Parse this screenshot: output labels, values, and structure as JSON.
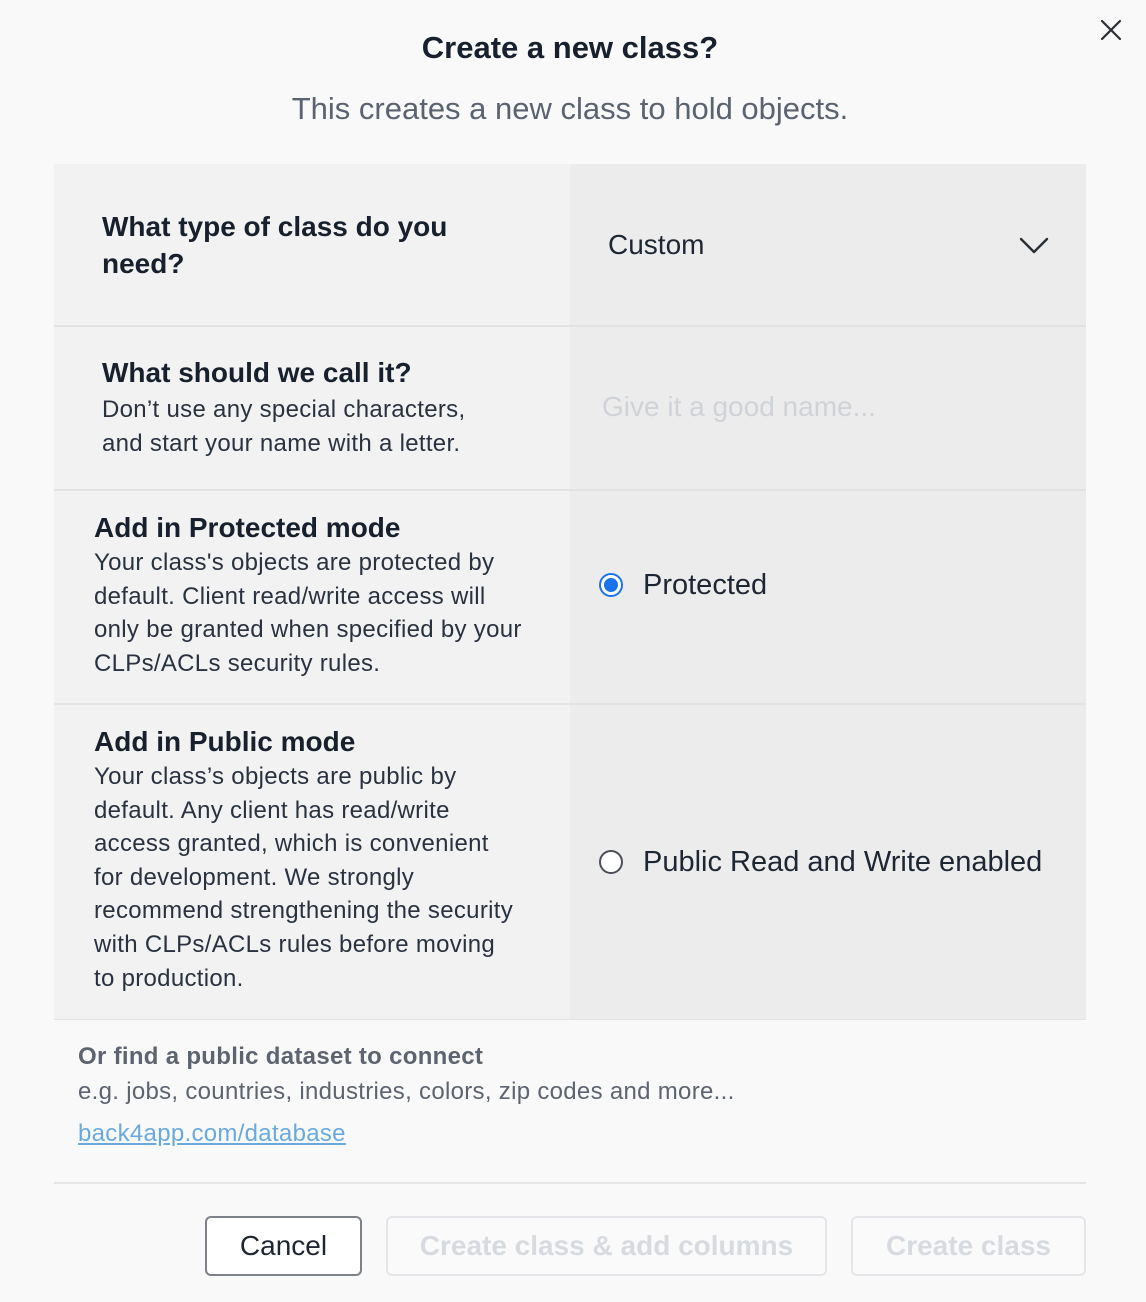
{
  "dialog": {
    "title": "Create a new class?",
    "subtitle": "This creates a new class to hold objects."
  },
  "type_row": {
    "label": "What type of class do you need?",
    "selected_value": "Custom",
    "icon": "chevron-down-icon"
  },
  "name_row": {
    "label": "What should we call it?",
    "description": "Don’t use any special characters, and start your name with a letter.",
    "input_value": "",
    "placeholder": "Give it a good name..."
  },
  "protected_row": {
    "label": "Add in Protected mode",
    "description": "Your class's objects are protected by default. Client read/write access will only be granted when specified by your CLPs/ACLs security rules.",
    "radio_label": "Protected",
    "checked": true
  },
  "public_row": {
    "label": "Add in Public mode",
    "description": "Your class’s objects are public by default. Any client has read/write access granted, which is convenient for development. We strongly recommend strengthening the security with CLPs/ACLs rules before moving to production.",
    "radio_label": "Public Read and Write enabled",
    "checked": false
  },
  "dataset": {
    "title": "Or find a public dataset to connect",
    "description": "e.g. jobs, countries, industries, colors, zip codes and more...",
    "link_text": "back4app.com/database"
  },
  "footer": {
    "cancel_label": "Cancel",
    "create_add_columns_label": "Create class & add columns",
    "create_label": "Create class"
  },
  "colors": {
    "accent": "#1a73e8",
    "link": "#6aa9de",
    "disabled_text": "#d7dbe0"
  }
}
